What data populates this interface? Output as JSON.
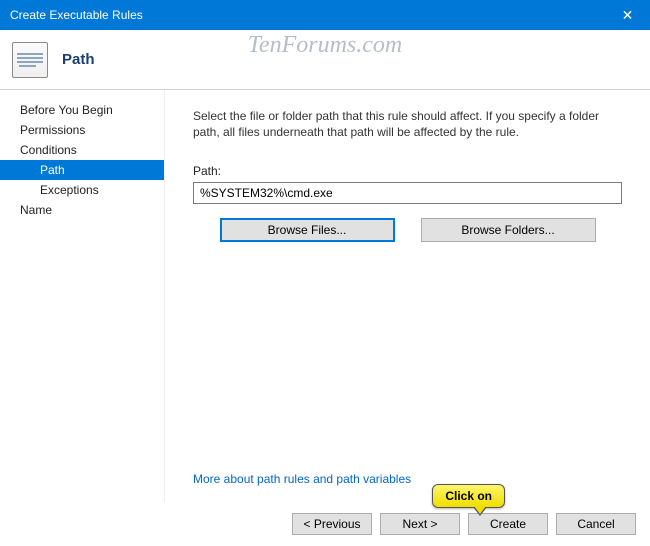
{
  "window": {
    "title": "Create Executable Rules",
    "close_symbol": "✕"
  },
  "header": {
    "title": "Path"
  },
  "sidebar": {
    "items": [
      {
        "label": "Before You Begin",
        "selected": false,
        "indent": false
      },
      {
        "label": "Permissions",
        "selected": false,
        "indent": false
      },
      {
        "label": "Conditions",
        "selected": false,
        "indent": false
      },
      {
        "label": "Path",
        "selected": true,
        "indent": true
      },
      {
        "label": "Exceptions",
        "selected": false,
        "indent": true
      },
      {
        "label": "Name",
        "selected": false,
        "indent": false
      }
    ]
  },
  "main": {
    "description": "Select the file or folder path that this rule should affect. If you specify a folder path, all files underneath that path will be affected by the rule.",
    "path_label": "Path:",
    "path_value": "%SYSTEM32%\\cmd.exe",
    "browse_files": "Browse Files...",
    "browse_folders": "Browse Folders...",
    "help_link": "More about path rules and path variables"
  },
  "footer": {
    "previous": "< Previous",
    "next": "Next >",
    "create": "Create",
    "cancel": "Cancel"
  },
  "annotation": {
    "callout": "Click on"
  },
  "watermark": "TenForums.com"
}
